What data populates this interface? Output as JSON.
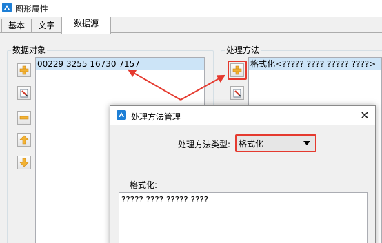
{
  "window": {
    "title": "图形属性",
    "icon": "app-logo-icon"
  },
  "tabs": [
    {
      "label": "基本",
      "active": false
    },
    {
      "label": "文字",
      "active": false
    },
    {
      "label": "数据源",
      "active": true
    }
  ],
  "data_objects": {
    "label": "数据对象",
    "items": [
      "00229 3255 16730 7157"
    ],
    "toolbar": [
      {
        "name": "add-icon",
        "tooltip": ""
      },
      {
        "name": "edit-icon",
        "tooltip": ""
      },
      {
        "name": "remove-icon",
        "tooltip": ""
      },
      {
        "name": "move-up-icon",
        "tooltip": ""
      },
      {
        "name": "move-down-icon",
        "tooltip": ""
      }
    ]
  },
  "processing": {
    "label": "处理方法",
    "items": [
      "格式化<????? ???? ????? ????>"
    ],
    "toolbar": [
      {
        "name": "add-icon"
      },
      {
        "name": "edit-icon"
      }
    ]
  },
  "dialog": {
    "title": "处理方法管理",
    "type_label": "处理方法类型:",
    "type_value": "格式化",
    "format_label": "格式化:",
    "format_value": "????? ???? ????? ????",
    "close_glyph": "✕"
  },
  "colors": {
    "highlight": "#e53a2f",
    "selection": "#cce4f7",
    "accent": "#1e7fd6"
  }
}
